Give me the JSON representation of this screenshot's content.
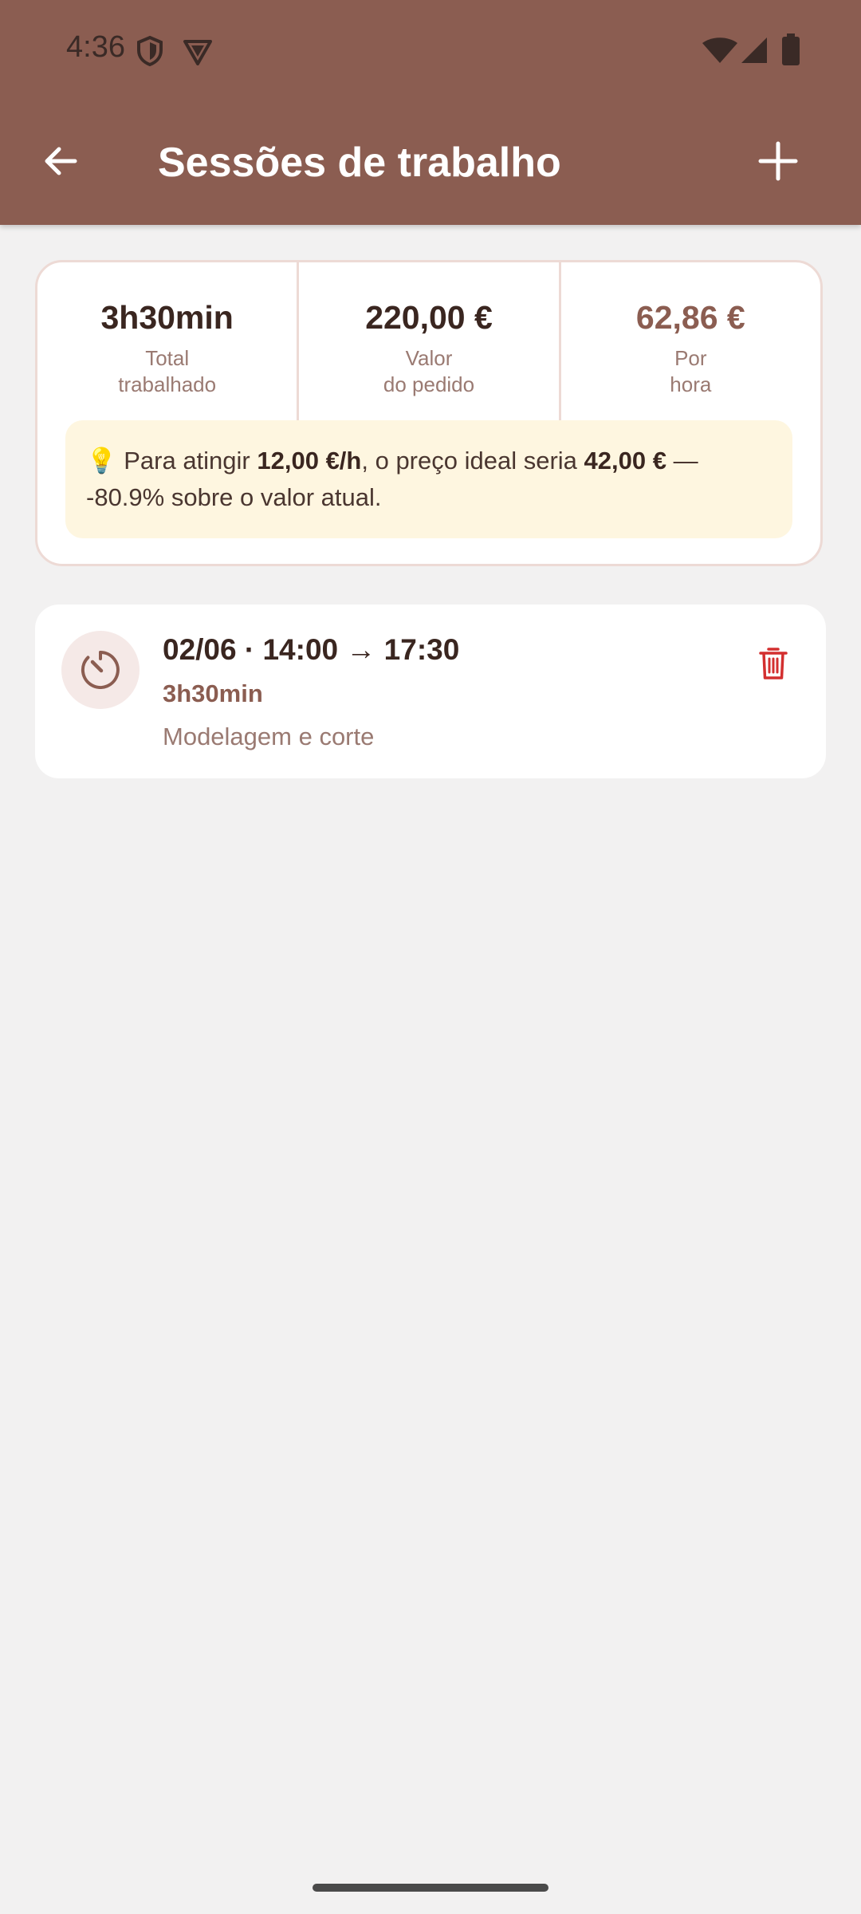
{
  "status_bar": {
    "time": "4:36",
    "left_icons": [
      "shield-icon",
      "vpn-shield-icon"
    ],
    "right_icons": [
      "wifi-icon",
      "signal-icon",
      "battery-icon"
    ]
  },
  "app_bar": {
    "title": "Sessões de trabalho",
    "back_icon": "arrow-back-icon",
    "add_icon": "plus-icon",
    "background_color": "#8B5D51"
  },
  "summary": {
    "stats": [
      {
        "value": "3h30min",
        "label_line1": "Total",
        "label_line2": "trabalhado"
      },
      {
        "value": "220,00 €",
        "label_line1": "Valor",
        "label_line2": "do pedido"
      },
      {
        "value": "62,86 €",
        "label_line1": "Por",
        "label_line2": "hora"
      }
    ],
    "tip": {
      "icon": "💡",
      "text_1": " Para atingir ",
      "rate": "12,00 €/h",
      "text_2": ", o preço ideal seria ",
      "ideal_price": "42,00 €",
      "text_3": " — -80.9% sobre o valor atual."
    }
  },
  "sessions": [
    {
      "time_range": "02/06 · 14:00 → 17:30",
      "duration": "3h30min",
      "description": "Modelagem e corte",
      "icon": "timer-icon",
      "delete_icon": "trash-icon",
      "delete_color": "#D32F2F"
    }
  ]
}
